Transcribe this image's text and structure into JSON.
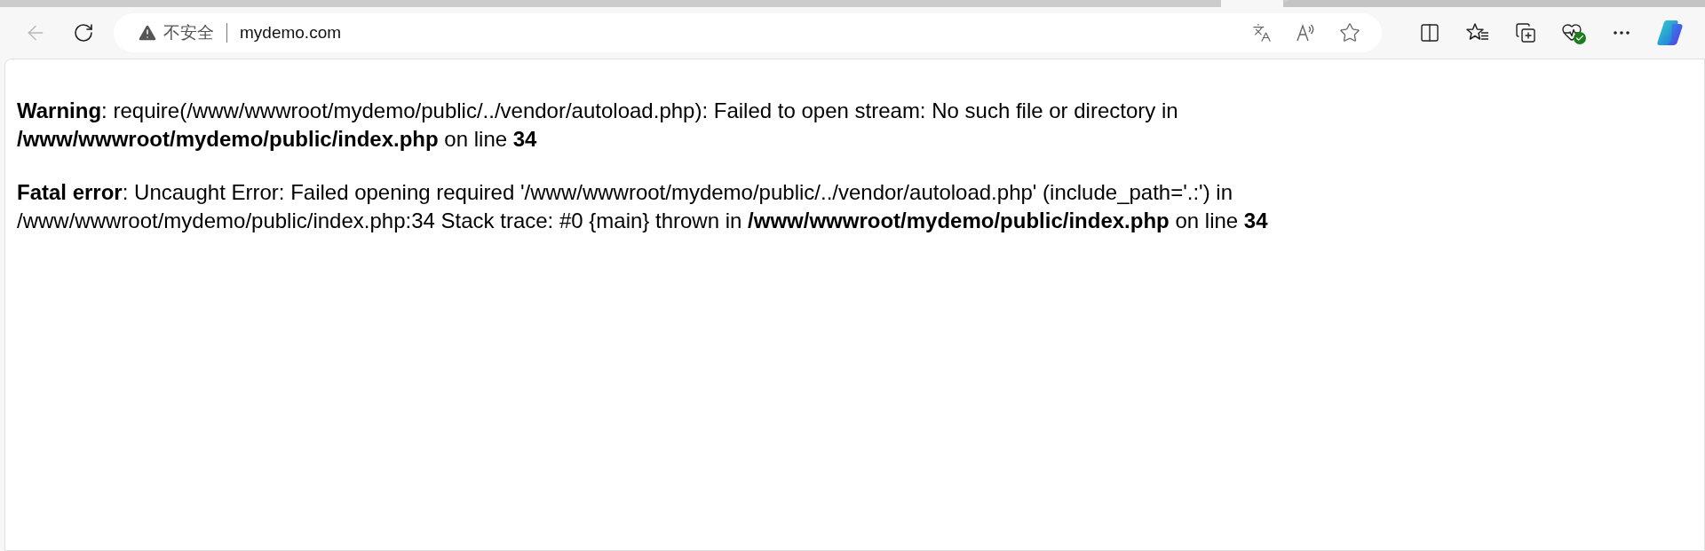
{
  "toolbar": {
    "back_button": {
      "disabled": true
    }
  },
  "address_bar": {
    "security_label": "不安全",
    "url": "mydemo.com"
  },
  "page": {
    "paragraphs": [
      "**Warning**: require(/www/wwwroot/mydemo/public/../vendor/autoload.php): Failed to open stream: No such file or directory in **/www/wwwroot/mydemo/public/index.php** on line **34**",
      "**Fatal error**: Uncaught Error: Failed opening required '/www/wwwroot/mydemo/public/../vendor/autoload.php' (include_path='.:') in /www/wwwroot/mydemo/public/index.php:34 Stack trace: #0 {main} thrown in **/www/wwwroot/mydemo/public/index.php** on line **34**"
    ]
  }
}
